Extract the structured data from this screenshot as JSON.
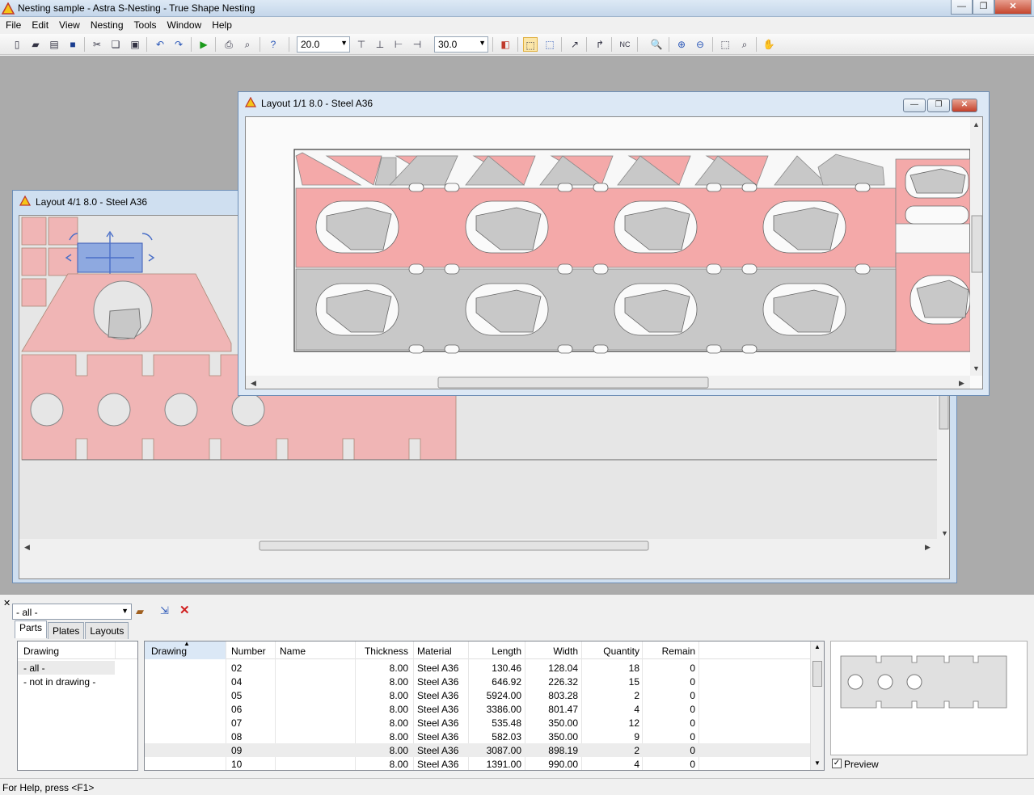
{
  "app": {
    "title": "Nesting sample - Astra S-Nesting - True Shape Nesting",
    "window_buttons": [
      "0",
      "1",
      "r"
    ]
  },
  "menu": [
    "File",
    "Edit",
    "View",
    "Nesting",
    "Tools",
    "Window",
    "Help"
  ],
  "toolbar": {
    "spacing_value": "20.0",
    "angle_value": "30.0",
    "icons": [
      "new-icon",
      "open-icon",
      "import-icon",
      "save-icon",
      "cut-icon",
      "copy-icon",
      "paste-icon",
      "undo-icon",
      "redo-icon",
      "run-nesting-icon",
      "print-icon",
      "print-preview-icon",
      "help-icon",
      "align-top-icon",
      "align-bottom-icon",
      "align-left-icon",
      "align-right-icon",
      "color-icon",
      "select-part-icon",
      "auto-select-icon",
      "move-part-icon",
      "rotate-icon",
      "nc-export-icon",
      "zoom-icon",
      "zoom-in-icon",
      "zoom-out-icon",
      "zoom-window-icon",
      "zoom-fit-icon",
      "pan-hand-icon"
    ]
  },
  "layout_front": {
    "title": "Layout 1/1 8.0 - Steel A36"
  },
  "layout_back": {
    "title": "Layout 4/1 8.0 - Steel A36"
  },
  "colors": {
    "part_red": "#f4a9a9",
    "part_gray": "#c8c8c8",
    "selected_blue": "#7f9fe0"
  },
  "bottom_panel": {
    "filter_value": "- all -",
    "tabs": [
      "Parts",
      "Plates",
      "Layouts"
    ],
    "drawing_list": {
      "header": "Drawing",
      "items": [
        "- all -",
        "- not in drawing -"
      ]
    },
    "parts_table": {
      "columns": [
        "Drawing",
        "Number",
        "Name",
        "Thickness",
        "Material",
        "Length",
        "Width",
        "Quantity",
        "Remain"
      ],
      "rows": [
        {
          "number": "02",
          "thickness": "8.00",
          "material": "Steel A36",
          "length": "130.46",
          "width": "128.04",
          "quantity": "18",
          "remain": "0"
        },
        {
          "number": "04",
          "thickness": "8.00",
          "material": "Steel A36",
          "length": "646.92",
          "width": "226.32",
          "quantity": "15",
          "remain": "0"
        },
        {
          "number": "05",
          "thickness": "8.00",
          "material": "Steel A36",
          "length": "5924.00",
          "width": "803.28",
          "quantity": "2",
          "remain": "0"
        },
        {
          "number": "06",
          "thickness": "8.00",
          "material": "Steel A36",
          "length": "3386.00",
          "width": "801.47",
          "quantity": "4",
          "remain": "0"
        },
        {
          "number": "07",
          "thickness": "8.00",
          "material": "Steel A36",
          "length": "535.48",
          "width": "350.00",
          "quantity": "12",
          "remain": "0"
        },
        {
          "number": "08",
          "thickness": "8.00",
          "material": "Steel A36",
          "length": "582.03",
          "width": "350.00",
          "quantity": "9",
          "remain": "0"
        },
        {
          "number": "09",
          "thickness": "8.00",
          "material": "Steel A36",
          "length": "3087.00",
          "width": "898.19",
          "quantity": "2",
          "remain": "0"
        },
        {
          "number": "10",
          "thickness": "8.00",
          "material": "Steel A36",
          "length": "1391.00",
          "width": "990.00",
          "quantity": "4",
          "remain": "0"
        }
      ]
    },
    "preview_label": "Preview"
  },
  "status": "For Help, press <F1>"
}
